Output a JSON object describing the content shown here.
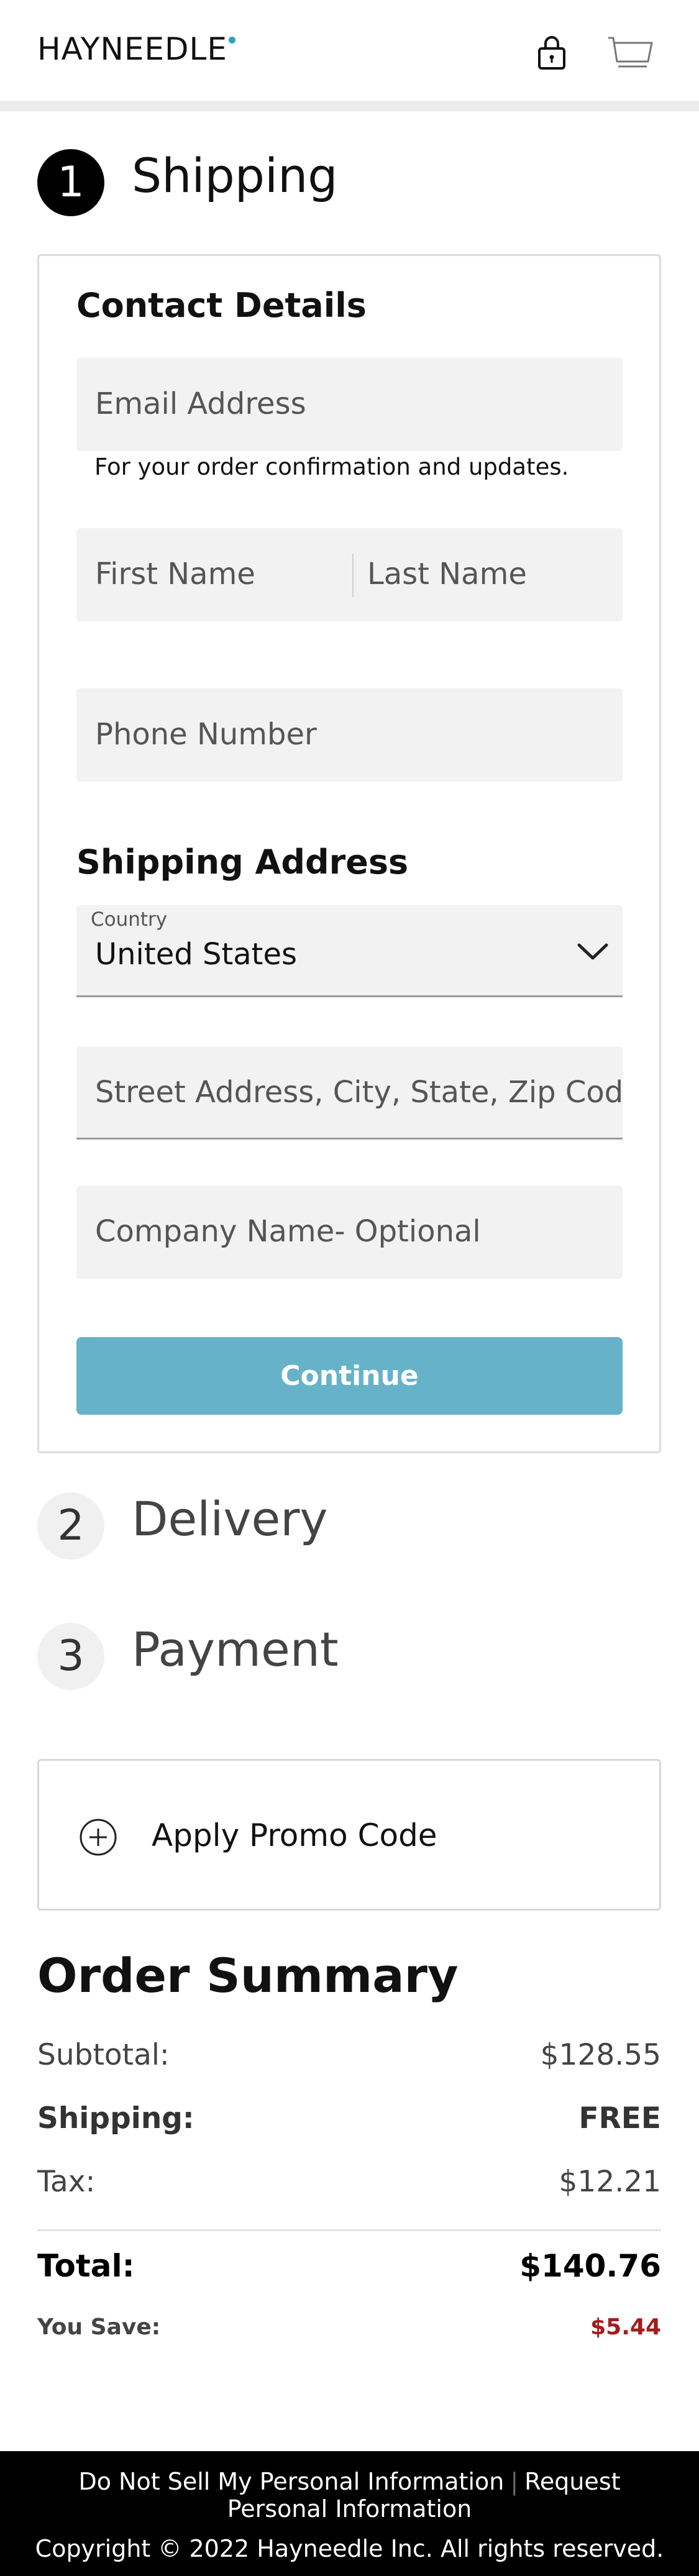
{
  "header": {
    "logo_text": "HAYNEEDLE",
    "accent_color": "#2aa3c9",
    "icons": [
      "lock-icon",
      "cart-icon"
    ]
  },
  "steps": [
    {
      "number": "1",
      "title": "Shipping",
      "active": true
    },
    {
      "number": "2",
      "title": "Delivery",
      "active": false
    },
    {
      "number": "3",
      "title": "Payment",
      "active": false
    }
  ],
  "contact": {
    "heading": "Contact Details",
    "email_placeholder": "Email Address",
    "email_hint": "For your order confirmation and updates.",
    "first_name_placeholder": "First Name",
    "last_name_placeholder": "Last Name",
    "phone_placeholder": "Phone Number"
  },
  "shipping_address": {
    "heading": "Shipping Address",
    "country_label": "Country",
    "country_value": "United States",
    "street_placeholder": "Street Address, City, State, Zip Cod",
    "company_placeholder": "Company Name- Optional"
  },
  "continue_label": "Continue",
  "continue_color": "#66b2c9",
  "promo": {
    "label": "Apply Promo Code"
  },
  "summary": {
    "title": "Order Summary",
    "subtotal_label": "Subtotal:",
    "subtotal_value": "$128.55",
    "shipping_label": "Shipping:",
    "shipping_value": "FREE",
    "tax_label": "Tax:",
    "tax_value": "$12.21",
    "total_label": "Total:",
    "total_value": "$140.76",
    "save_label": "You Save:",
    "save_value": "$5.44",
    "save_color": "#a51c1c"
  },
  "footer": {
    "link_do_not_sell": "Do Not Sell My Personal Information",
    "link_request": "Request Personal Information",
    "copyright": "Copyright © 2022 Hayneedle Inc. All rights reserved."
  }
}
